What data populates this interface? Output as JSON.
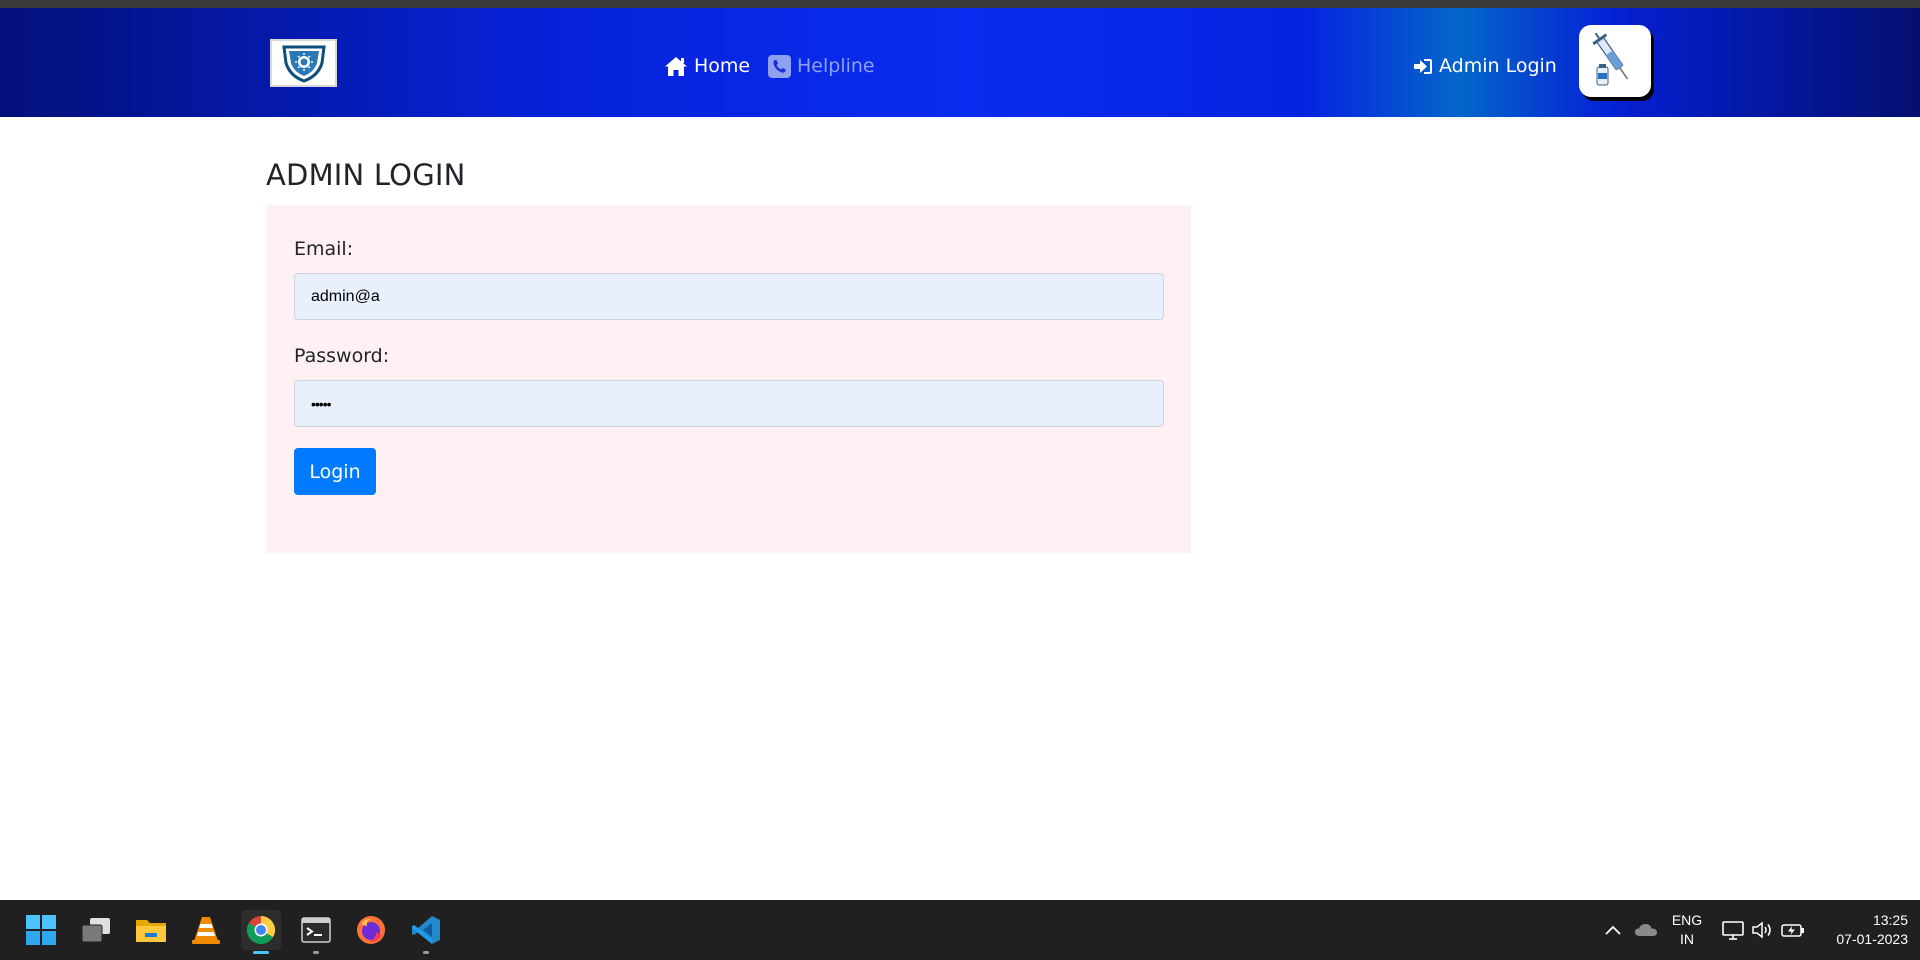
{
  "navbar": {
    "logo_icon": "shield-virus-logo-icon",
    "links": {
      "home": "Home",
      "helpline": "Helpline",
      "admin_login": "Admin Login"
    },
    "badge_icon": "vaccine-syringe-icon",
    "colors": {
      "gradient_dark": "#04107a",
      "gradient_bright": "#0a2cf0",
      "helpline_text": "#8fa0f0"
    }
  },
  "page": {
    "title": "ADMIN LOGIN"
  },
  "login_form": {
    "email_label": "Email:",
    "email_value": "admin@a",
    "password_label": "Password:",
    "password_masked": "•••••",
    "submit_label": "Login",
    "panel_color": "#fff0f3",
    "input_fill": "#e8f0fe",
    "button_color": "#007bff"
  },
  "taskbar": {
    "apps": [
      "start-icon",
      "task-view-icon",
      "file-explorer-icon",
      "vlc-icon",
      "chrome-icon",
      "terminal-icon",
      "firefox-icon",
      "vscode-icon"
    ],
    "focused_app": "chrome-icon",
    "tray": {
      "lang_line1": "ENG",
      "lang_line2": "IN",
      "time": "13:25",
      "date": "07-01-2023"
    }
  }
}
